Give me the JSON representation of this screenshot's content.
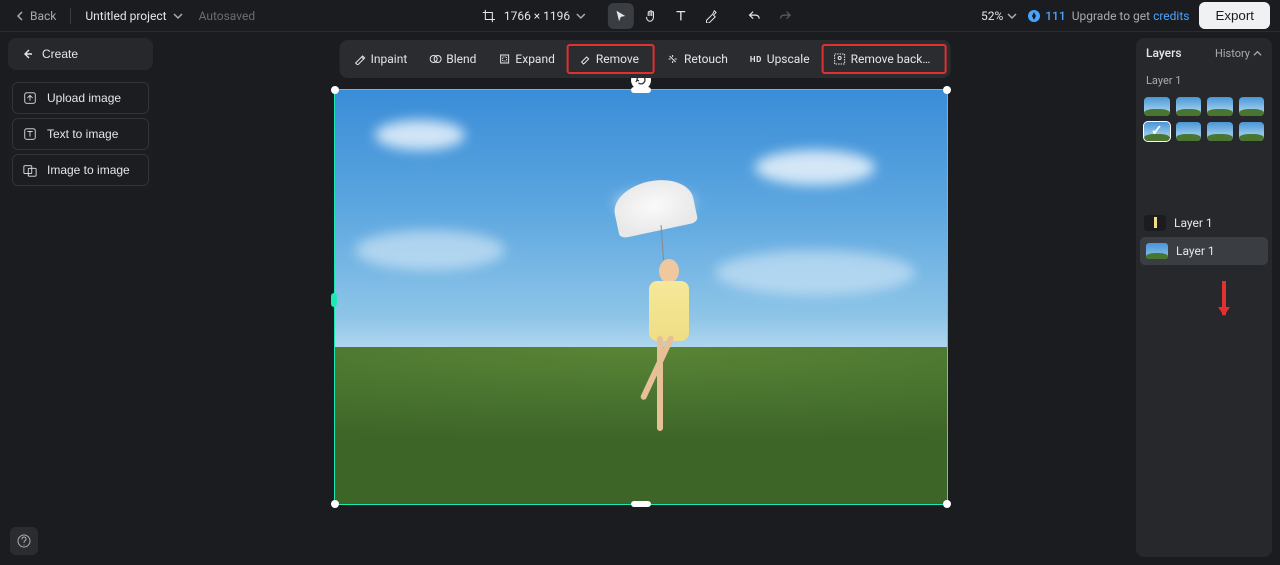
{
  "header": {
    "back": "Back",
    "project_name": "Untitled project",
    "autosaved": "Autosaved",
    "dimensions": "1766 × 1196",
    "zoom": "52%",
    "credits_value": "111",
    "upgrade_prefix": "Upgrade to get ",
    "upgrade_link": "credits",
    "export": "Export"
  },
  "left": {
    "create": "Create",
    "upload": "Upload image",
    "text2img": "Text to image",
    "img2img": "Image to image"
  },
  "toolbar": {
    "inpaint": "Inpaint",
    "blend": "Blend",
    "expand": "Expand",
    "remove": "Remove",
    "retouch": "Retouch",
    "upscale": "Upscale",
    "remove_bg": "Remove back…"
  },
  "right": {
    "title": "Layers",
    "history": "History",
    "layer_label": "Layer 1",
    "layer1": "Layer 1",
    "layer2": "Layer 1"
  }
}
